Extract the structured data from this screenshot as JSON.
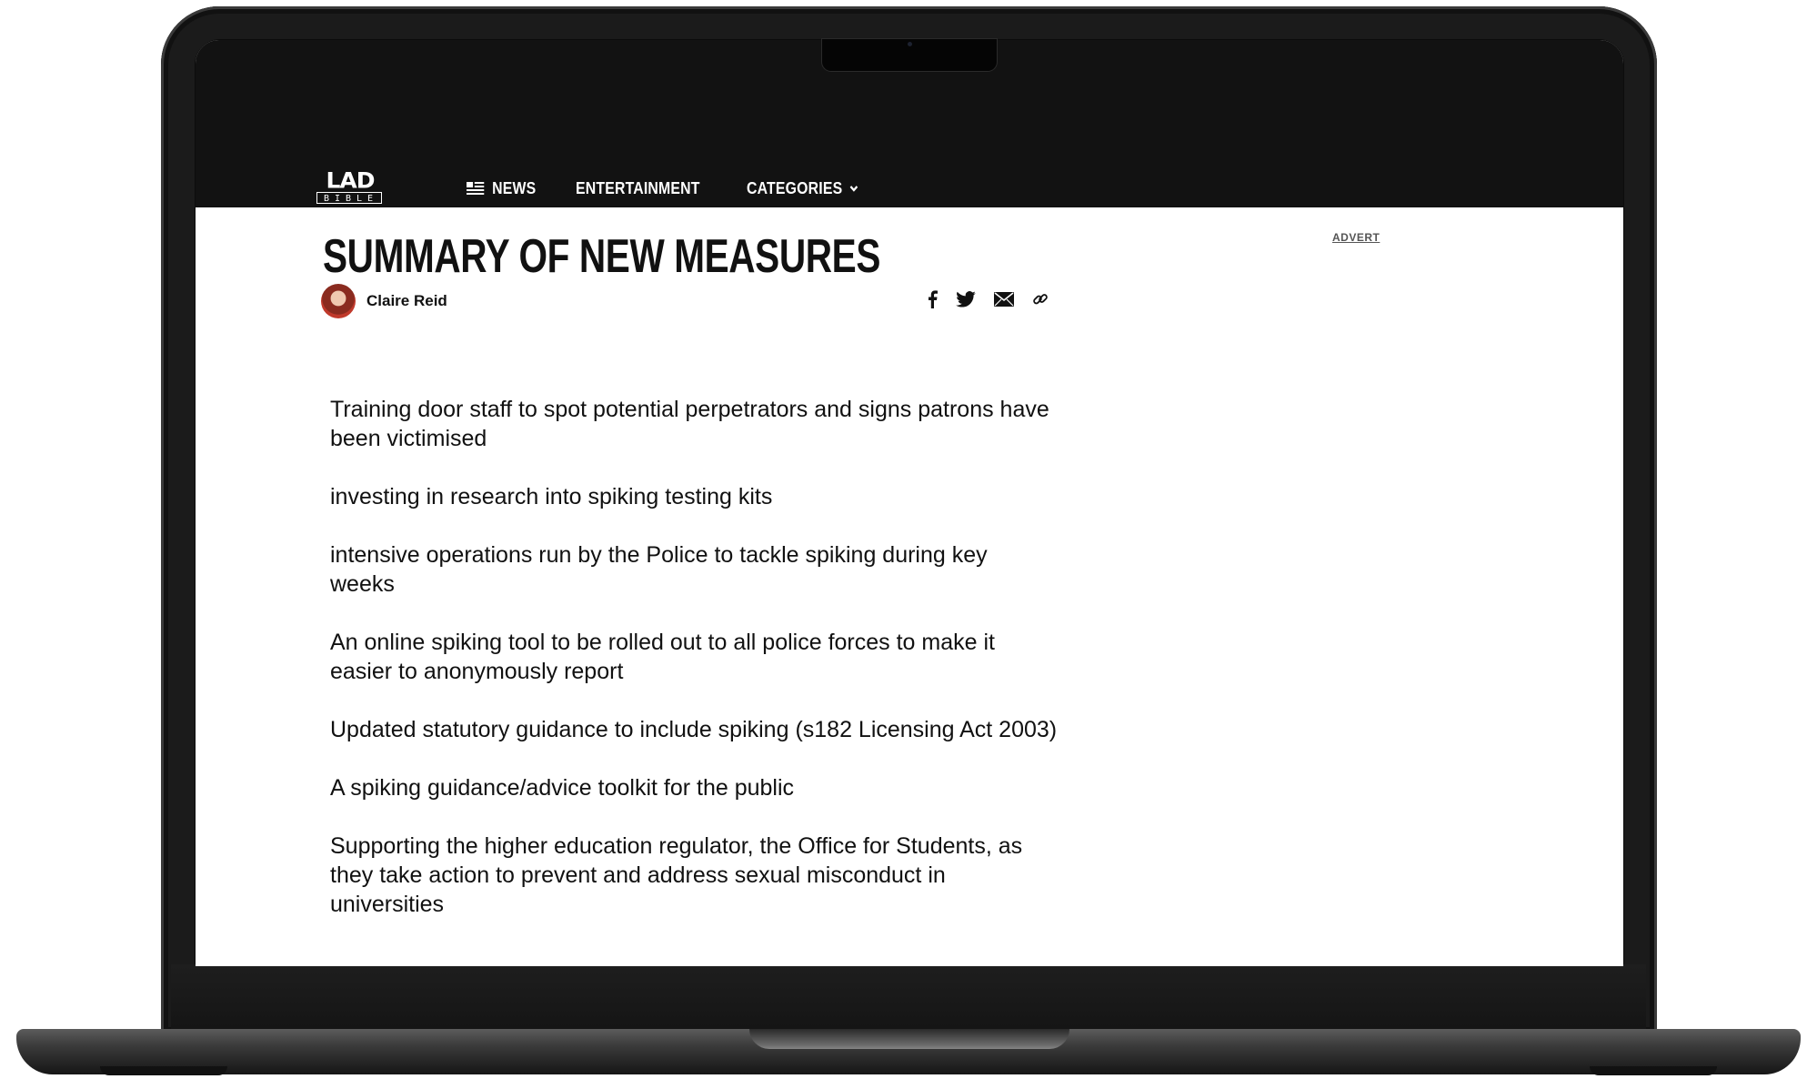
{
  "site": {
    "logo_top": "LAD",
    "logo_bottom": "BIBLE"
  },
  "nav": {
    "items": [
      {
        "label": "NEWS",
        "icon": "news-icon"
      },
      {
        "label": "ENTERTAINMENT"
      },
      {
        "label": "CATEGORIES",
        "icon": "chevron-down-icon"
      }
    ]
  },
  "article": {
    "title": "SUMMARY OF NEW MEASURES",
    "author": "Claire Reid",
    "share_icons": [
      "facebook-icon",
      "twitter-icon",
      "email-icon",
      "link-icon"
    ],
    "paragraphs": [
      "Training door staff to spot potential perpetrators and signs patrons have been victimised",
      "investing in research into spiking testing kits",
      "intensive operations run by the Police to tackle spiking during key weeks",
      "An online spiking tool to be rolled out to all police forces to make it easier to anonymously report",
      "Updated statutory guidance to include spiking (s182 Licensing Act 2003)",
      "A spiking guidance/advice toolkit for the public",
      "Supporting the higher education regulator, the Office for Students, as they take action to prevent and address sexual misconduct in universities"
    ]
  },
  "sidebar": {
    "advert_label": "ADVERT"
  },
  "colors": {
    "topbar": "#121212",
    "text": "#111111",
    "page": "#ffffff"
  }
}
